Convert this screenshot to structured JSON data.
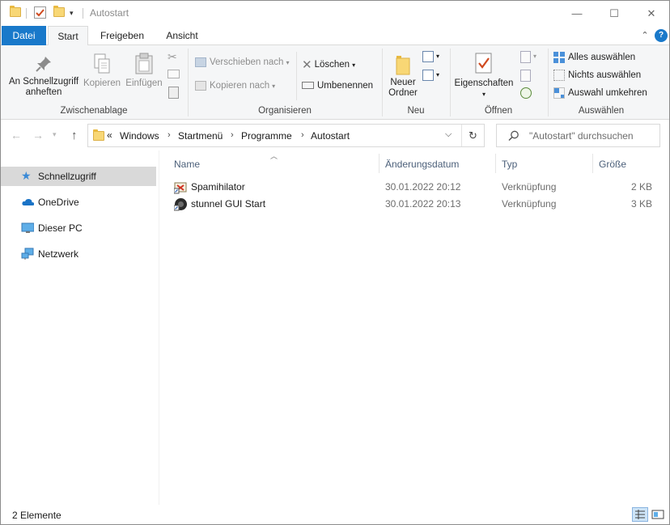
{
  "window": {
    "title": "Autostart",
    "controls": {
      "minimize": "—",
      "maximize": "☐",
      "close": "✕"
    }
  },
  "tabs": [
    {
      "label": "Datei",
      "active": false
    },
    {
      "label": "Start",
      "active": true
    },
    {
      "label": "Freigeben",
      "active": false
    },
    {
      "label": "Ansicht",
      "active": false
    }
  ],
  "ribbon": {
    "clipboard": {
      "label": "Zwischenablage",
      "pin_line1": "An Schnellzugriff",
      "pin_line2": "anheften",
      "copy": "Kopieren",
      "paste": "Einfügen"
    },
    "organize": {
      "label": "Organisieren",
      "move_to": "Verschieben nach",
      "copy_to": "Kopieren nach",
      "delete": "Löschen",
      "rename": "Umbenennen"
    },
    "new": {
      "label": "Neu",
      "new_folder_line1": "Neuer",
      "new_folder_line2": "Ordner"
    },
    "open": {
      "label": "Öffnen",
      "properties": "Eigenschaften"
    },
    "select": {
      "label": "Auswählen",
      "select_all": "Alles auswählen",
      "select_none": "Nichts auswählen",
      "invert": "Auswahl umkehren"
    }
  },
  "address": {
    "overflow": "«",
    "crumbs": [
      "Windows",
      "Startmenü",
      "Programme",
      "Autostart"
    ],
    "search_placeholder": "\"Autostart\" durchsuchen"
  },
  "nav_pane": [
    {
      "label": "Schnellzugriff",
      "icon": "star-icon",
      "selected": true
    },
    {
      "label": "OneDrive",
      "icon": "cloud-icon",
      "selected": false
    },
    {
      "label": "Dieser PC",
      "icon": "monitor-icon",
      "selected": false
    },
    {
      "label": "Netzwerk",
      "icon": "network-icon",
      "selected": false
    }
  ],
  "columns": {
    "name": "Name",
    "date": "Änderungsdatum",
    "type": "Typ",
    "size": "Größe"
  },
  "files": [
    {
      "name": "Spamihilator",
      "date": "30.01.2022 20:12",
      "type": "Verknüpfung",
      "size": "2 KB",
      "icon": "spamihilator-shortcut-icon"
    },
    {
      "name": "stunnel GUI Start",
      "date": "30.01.2022 20:13",
      "type": "Verknüpfung",
      "size": "3 KB",
      "icon": "stunnel-shortcut-icon"
    }
  ],
  "status": {
    "item_count": "2 Elemente"
  },
  "colors": {
    "accent": "#1979ca",
    "selection": "#d9d9d9",
    "folder": "#f8d775"
  }
}
